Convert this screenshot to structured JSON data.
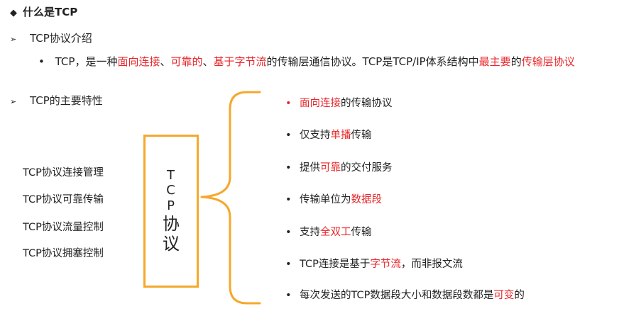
{
  "title": {
    "bullet": "◆",
    "text": "什么是TCP"
  },
  "section1": {
    "arrow": "➢",
    "heading": "TCP协议介绍"
  },
  "intro": {
    "bullet": "•",
    "parts": [
      {
        "text": "TCP，是一种",
        "red": false
      },
      {
        "text": "面向连接",
        "red": true
      },
      {
        "text": "、",
        "red": false
      },
      {
        "text": "可靠的",
        "red": true
      },
      {
        "text": "、",
        "red": false
      },
      {
        "text": "基于字节流",
        "red": true
      },
      {
        "text": "的传输层通信协议。TCP是TCP/IP体系结构中",
        "red": false
      },
      {
        "text": "最主要",
        "red": true
      },
      {
        "text": "的",
        "red": false
      },
      {
        "text": "传输层协议",
        "red": true
      }
    ]
  },
  "section2": {
    "arrow": "➢",
    "heading": "TCP的主要特性"
  },
  "left_items": [
    "TCP协议连接管理",
    "TCP协议可靠传输",
    "TCP协议流量控制",
    "TCP协议拥塞控制"
  ],
  "box": {
    "line1": "T",
    "line2": "C",
    "line3": "P",
    "line4": "协",
    "line5": "议"
  },
  "features": [
    {
      "bullet": "•",
      "bullet_red": true,
      "parts": [
        {
          "text": "面向连接",
          "red": true
        },
        {
          "text": "的传输协议",
          "red": false
        }
      ]
    },
    {
      "bullet": "•",
      "parts": [
        {
          "text": "仅支持",
          "red": false
        },
        {
          "text": "单播",
          "red": true
        },
        {
          "text": "传输",
          "red": false
        }
      ]
    },
    {
      "bullet": "•",
      "parts": [
        {
          "text": "提供",
          "red": false
        },
        {
          "text": "可靠",
          "red": true
        },
        {
          "text": "的交付服务",
          "red": false
        }
      ]
    },
    {
      "bullet": "•",
      "parts": [
        {
          "text": "传输单位为",
          "red": false
        },
        {
          "text": "数据段",
          "red": true
        }
      ]
    },
    {
      "bullet": "•",
      "parts": [
        {
          "text": "支持",
          "red": false
        },
        {
          "text": "全双工",
          "red": true
        },
        {
          "text": "传输",
          "red": false
        }
      ]
    },
    {
      "bullet": "•",
      "parts": [
        {
          "text": "TCP连接是基于",
          "red": false
        },
        {
          "text": "字节流",
          "red": true
        },
        {
          "text": "，而非报文流",
          "red": false
        }
      ]
    },
    {
      "bullet": "•",
      "parts": [
        {
          "text": "每次发送的TCP数据段大小和数据段数都是",
          "red": false
        },
        {
          "text": "可变",
          "red": true
        },
        {
          "text": "的",
          "red": false
        }
      ]
    }
  ],
  "colors": {
    "accent_red": "#e8262a",
    "box_orange": "#f5a82b"
  }
}
